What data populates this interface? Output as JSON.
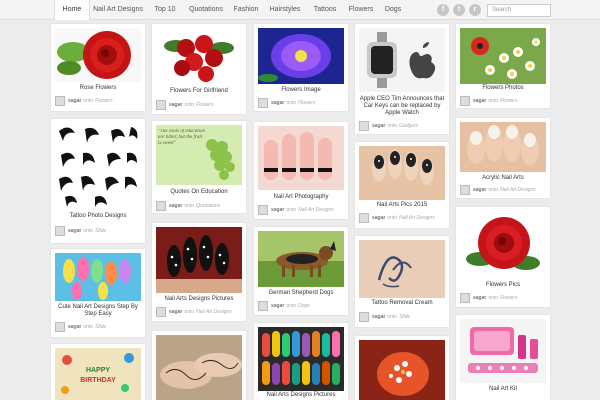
{
  "nav": {
    "items": [
      "Home",
      "Nail Art Designs",
      "Top 10",
      "Quotations",
      "Fashion",
      "Hairstyles",
      "Tattoos",
      "Flowers",
      "Dogs"
    ],
    "social_icons": [
      "facebook-icon",
      "twitter-icon",
      "rss-icon"
    ],
    "search_placeholder": "Search"
  },
  "pins": [
    {
      "title": "Rose Flowers",
      "user": "sagar",
      "onto": "onto",
      "board": "Flowers"
    },
    {
      "title": "Tattoo Photo Designs",
      "user": "sagar",
      "onto": "onto",
      "board": "Slide"
    },
    {
      "title": "Cute Nail Art Designs Step By Step Easy",
      "user": "sagar",
      "onto": "onto",
      "board": "Slide"
    },
    {
      "title": "Flowers For Girlfriend",
      "user": "sagar",
      "onto": "onto",
      "board": "Flowers"
    },
    {
      "title": "Quotes On Education",
      "user": "sagar",
      "onto": "onto",
      "board": "Quotations"
    },
    {
      "title": "Nail Arts Designs Pictures",
      "user": "sagar",
      "onto": "onto",
      "board": "Nail Art Designs"
    },
    {
      "title": "Flowers Image",
      "user": "sagar",
      "onto": "onto",
      "board": "Flowers"
    },
    {
      "title": "Nail Art Photography",
      "user": "sagar",
      "onto": "onto",
      "board": "Nail Art Designs"
    },
    {
      "title": "German Shepherd Dogs",
      "user": "sagar",
      "onto": "onto",
      "board": "Dogs"
    },
    {
      "title": "Nail Arts Designs Pictures",
      "user": "",
      "onto": "",
      "board": ""
    },
    {
      "title": "Apple CEO Tim Announces that Car Keys can be replaced by Apple Watch",
      "user": "sagar",
      "onto": "onto",
      "board": "Gadgets"
    },
    {
      "title": "Nail Arts Pics 2015",
      "user": "sagar",
      "onto": "onto",
      "board": "Nail Art Designs"
    },
    {
      "title": "Tattoo Removal Cream",
      "user": "sagar",
      "onto": "onto",
      "board": "Slide"
    },
    {
      "title": "Flowers Photos",
      "user": "sagar",
      "onto": "onto",
      "board": "Flowers"
    },
    {
      "title": "Acrylic Nail Arts",
      "user": "sagar",
      "onto": "onto",
      "board": "Nail Art Designs"
    },
    {
      "title": "Flowers Pics",
      "user": "sagar",
      "onto": "onto",
      "board": "Flowers"
    },
    {
      "title": "Nail Art Kit",
      "user": "",
      "onto": "",
      "board": ""
    }
  ],
  "birthday_card": {
    "line1": "HAPPY",
    "line2": "BIRTHDAY"
  },
  "quote_card": {
    "text": "\"The roots of education are bitter, but the fruit is sweet\""
  },
  "brand_colors": {
    "rose": "#d01818",
    "leaf": "#3c7d2a",
    "nav_bg": "#f4f4f4",
    "page_bg": "#ececec"
  }
}
